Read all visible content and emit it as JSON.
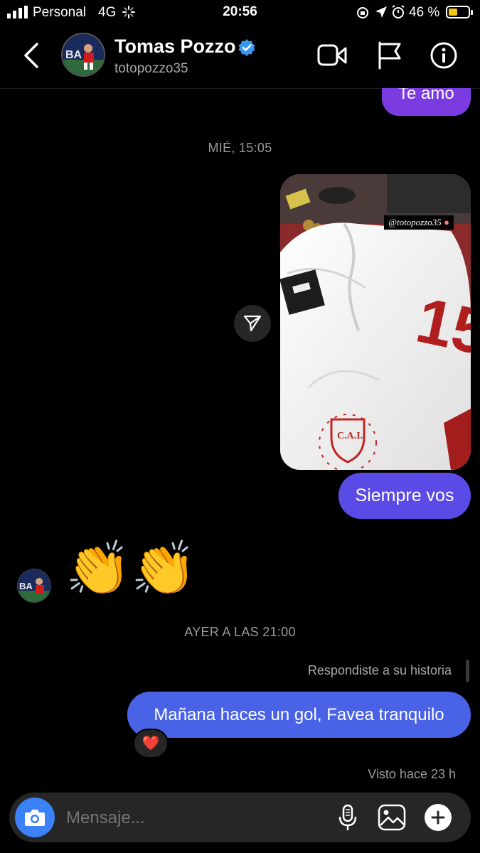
{
  "status_bar": {
    "carrier": "Personal",
    "network": "4G",
    "time": "20:56",
    "battery_percent": "46 %",
    "battery_level": 0.46
  },
  "header": {
    "name": "Tomas Pozzo",
    "handle": "totopozzo35",
    "icons": [
      "back-chevron-icon",
      "verified-badge-icon",
      "video-call-icon",
      "flag-icon",
      "info-icon"
    ]
  },
  "messages": {
    "prev_sent": "Te amo",
    "timestamp_1": "MIÉ, 15:05",
    "story_tag": "@totopozzo35",
    "sent_1": "Siempre vos",
    "received_emoji": "👏👏",
    "timestamp_2": "AYER A LAS 21:00",
    "reply_note": "Respondiste a su historia",
    "sent_2": "Mañana haces un gol, Favea tranquilo",
    "reaction": "❤️",
    "seen": "Visto hace 23 h"
  },
  "composer": {
    "placeholder": "Mensaje...",
    "icons": [
      "camera-icon",
      "microphone-icon",
      "gallery-icon",
      "plus-icon"
    ]
  },
  "colors": {
    "bubble_purple": "#7a3ce0",
    "bubble_violet": "#5a4ae6",
    "bubble_blue": "#4a63e6",
    "camera_blue": "#3b82f6",
    "verified": "#3897f0",
    "background": "#000000"
  }
}
